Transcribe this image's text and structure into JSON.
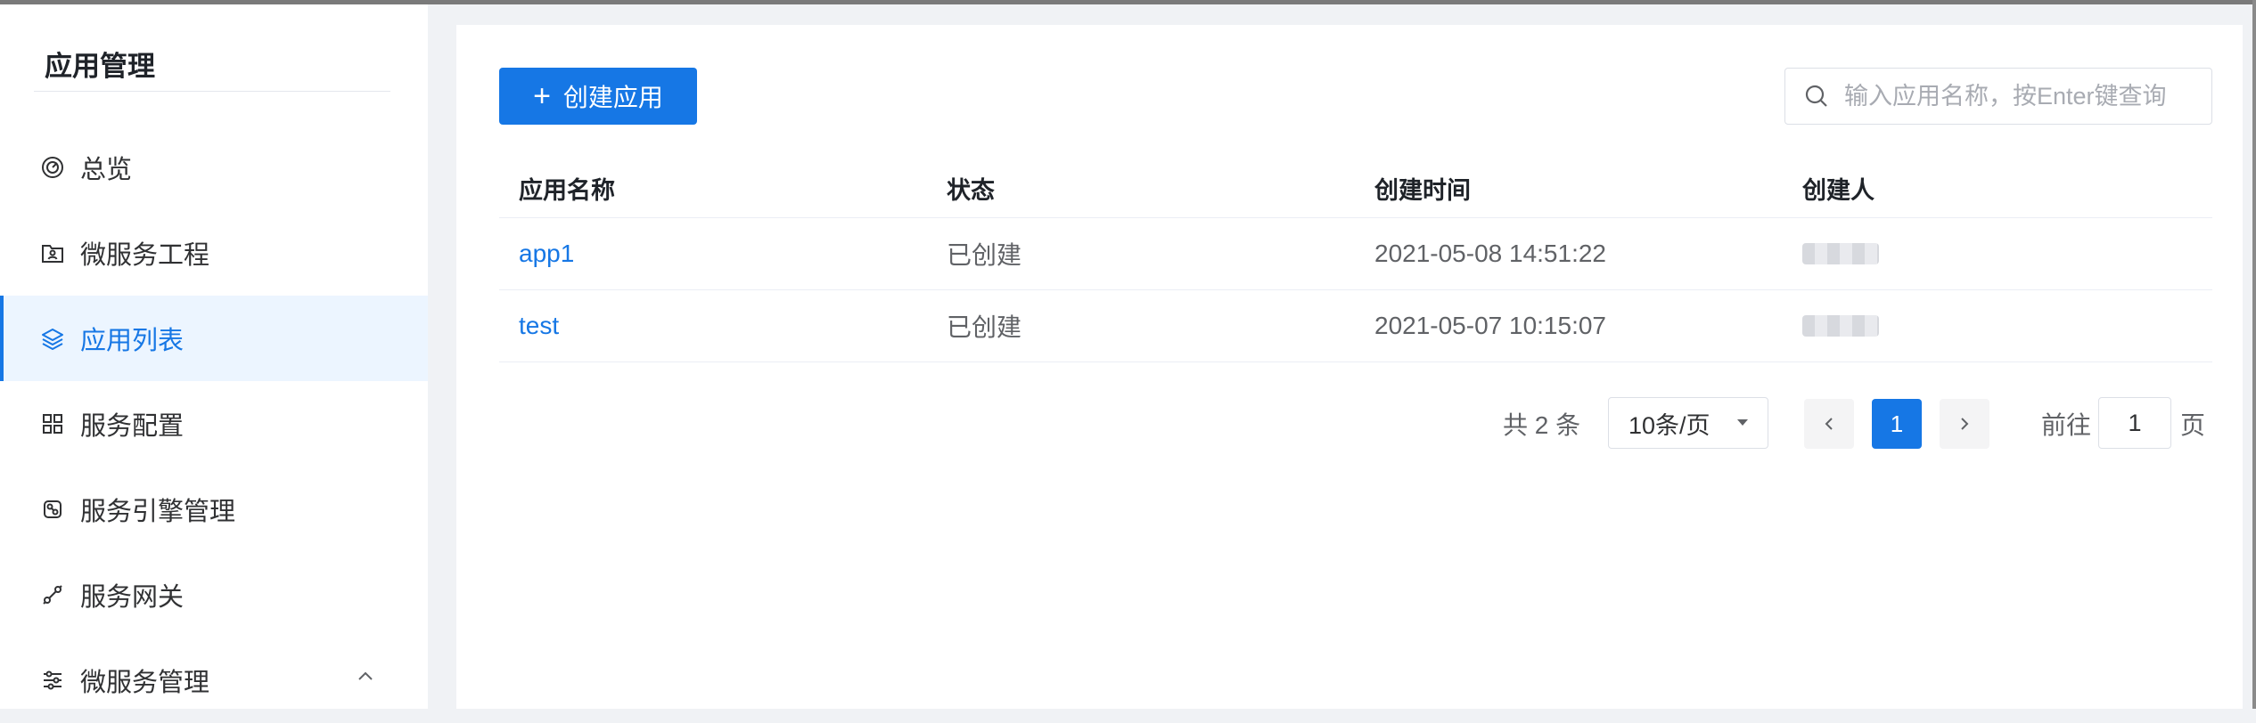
{
  "sidebar": {
    "title": "应用管理",
    "items": [
      {
        "label": "总览",
        "icon": "dashboard-icon"
      },
      {
        "label": "微服务工程",
        "icon": "folder-user-icon"
      },
      {
        "label": "应用列表",
        "icon": "layers-icon",
        "active": true
      },
      {
        "label": "服务配置",
        "icon": "grid-icon"
      },
      {
        "label": "服务引擎管理",
        "icon": "engine-icon"
      },
      {
        "label": "服务网关",
        "icon": "gateway-icon"
      },
      {
        "label": "微服务管理",
        "icon": "sliders-icon",
        "expandable": true
      }
    ]
  },
  "toolbar": {
    "create_label": "创建应用",
    "search_placeholder": "输入应用名称，按Enter键查询"
  },
  "table": {
    "columns": [
      "应用名称",
      "状态",
      "创建时间",
      "创建人"
    ],
    "rows": [
      {
        "name": "app1",
        "status": "已创建",
        "created_at": "2021-05-08 14:51:22",
        "creator": ""
      },
      {
        "name": "test",
        "status": "已创建",
        "created_at": "2021-05-07 10:15:07",
        "creator": ""
      }
    ]
  },
  "pagination": {
    "total_text": "共 2 条",
    "page_size": "10条/页",
    "current_page": "1",
    "goto_prefix": "前往",
    "goto_value": "1",
    "goto_suffix": "页"
  },
  "colors": {
    "accent": "#1677e5",
    "active_bg": "#ecf5ff",
    "background": "#f0f2f5"
  }
}
